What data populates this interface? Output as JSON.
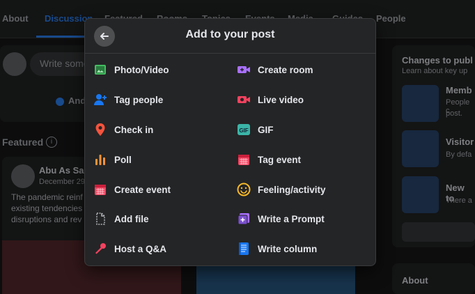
{
  "nav": {
    "tabs": [
      "About",
      "Discussion",
      "Featured",
      "Rooms",
      "Topics",
      "Events",
      "Media",
      "Guides",
      "People"
    ]
  },
  "composer": {
    "placeholder": "Write some",
    "anon_label": "And"
  },
  "featured": {
    "heading": "Featured",
    "author": "Abu As Sam",
    "date": "December 29",
    "text1": "The pandemic reinf",
    "text2": "existing tendencies",
    "text3": "disruptions and rev"
  },
  "right": {
    "title": "Changes to publ",
    "subtitle": "Learn about key up",
    "item1_title": "Memb",
    "item1_sub1": "People c",
    "item1_sub2": "post.",
    "item2_title": "Visitor",
    "item2_sub": "By defa",
    "item3_title": "New to",
    "item3_sub": "There a",
    "about": "About"
  },
  "modal": {
    "title": "Add to your post",
    "left": [
      {
        "label": "Photo/Video",
        "icon": "photo-video-icon"
      },
      {
        "label": "Tag people",
        "icon": "tag-people-icon"
      },
      {
        "label": "Check in",
        "icon": "location-pin-icon"
      },
      {
        "label": "Poll",
        "icon": "poll-icon"
      },
      {
        "label": "Create event",
        "icon": "calendar-icon"
      },
      {
        "label": "Add file",
        "icon": "file-icon"
      },
      {
        "label": "Host a Q&A",
        "icon": "microphone-icon"
      }
    ],
    "right": [
      {
        "label": "Create room",
        "icon": "video-camera-plus-icon"
      },
      {
        "label": "Live video",
        "icon": "live-video-icon"
      },
      {
        "label": "GIF",
        "icon": "gif-icon"
      },
      {
        "label": "Tag event",
        "icon": "tag-event-icon"
      },
      {
        "label": "Feeling/activity",
        "icon": "smiley-icon"
      },
      {
        "label": "Write a Prompt",
        "icon": "prompt-icon"
      },
      {
        "label": "Write column",
        "icon": "column-icon"
      }
    ]
  },
  "colors": {
    "accent": "#2d88ff",
    "green": "#45bd62",
    "blue": "#1877f2",
    "red": "#f3425f",
    "orange": "#f7b928",
    "purple": "#a970ff",
    "teal": "#3bb4a7"
  }
}
